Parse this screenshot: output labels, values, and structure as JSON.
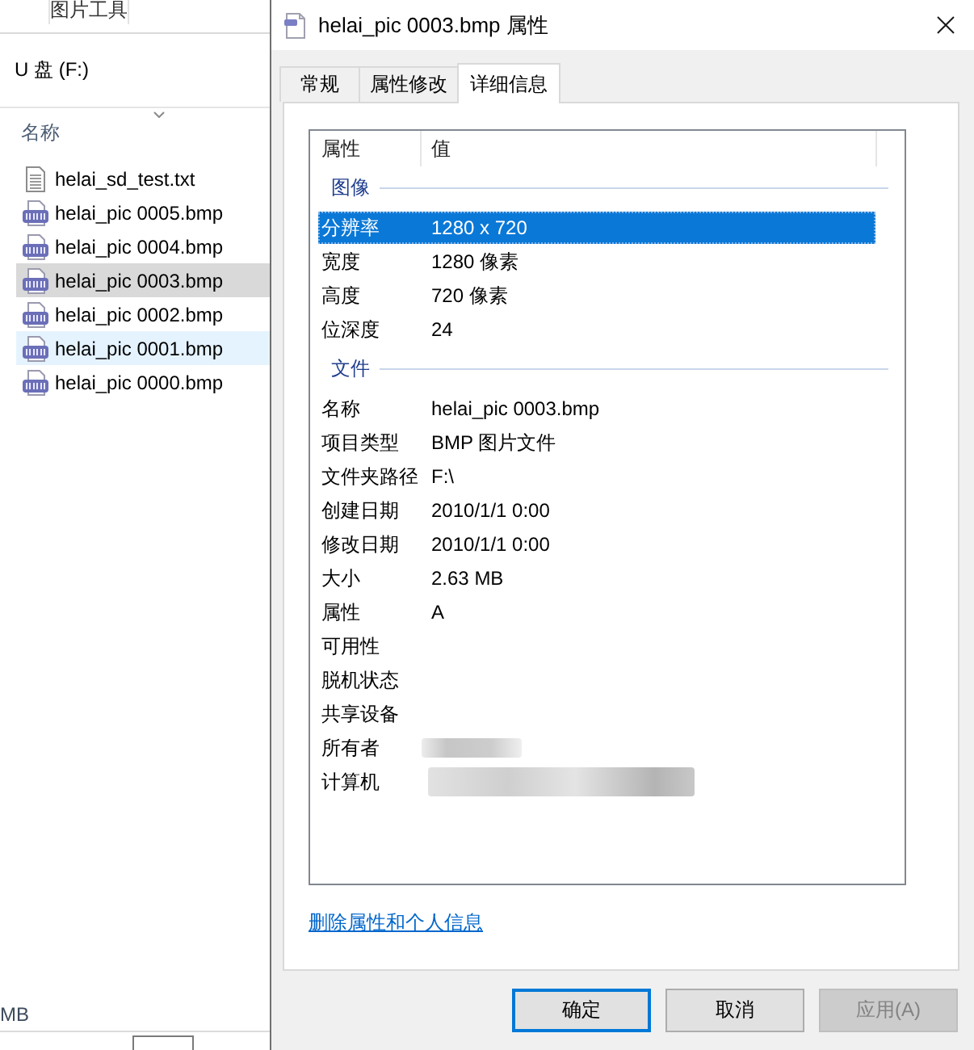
{
  "explorer": {
    "ribbon_tab": "图片工具",
    "location": "U 盘 (F:)",
    "column_header": "名称",
    "files": [
      {
        "name": "helai_sd_test.txt",
        "kind": "text",
        "selected": false,
        "hovered": false
      },
      {
        "name": "helai_pic 0005.bmp",
        "kind": "image",
        "selected": false,
        "hovered": false
      },
      {
        "name": "helai_pic 0004.bmp",
        "kind": "image",
        "selected": false,
        "hovered": false
      },
      {
        "name": "helai_pic 0003.bmp",
        "kind": "image",
        "selected": true,
        "hovered": false
      },
      {
        "name": "helai_pic 0002.bmp",
        "kind": "image",
        "selected": false,
        "hovered": false
      },
      {
        "name": "helai_pic 0001.bmp",
        "kind": "image",
        "selected": false,
        "hovered": true
      },
      {
        "name": "helai_pic 0000.bmp",
        "kind": "image",
        "selected": false,
        "hovered": false
      }
    ],
    "status_text": "MB"
  },
  "dialog": {
    "title": "helai_pic 0003.bmp 属性",
    "tabs": [
      {
        "label": "常规",
        "selected": false
      },
      {
        "label": "属性修改",
        "selected": false
      },
      {
        "label": "详细信息",
        "selected": true
      }
    ],
    "columns": [
      "属性",
      "值"
    ],
    "groups": [
      {
        "label": "图像",
        "rows": [
          {
            "property": "分辨率",
            "value": "1280 x 720",
            "selected": true,
            "redacted": false
          },
          {
            "property": "宽度",
            "value": "1280 像素",
            "selected": false,
            "redacted": false
          },
          {
            "property": "高度",
            "value": "720 像素",
            "selected": false,
            "redacted": false
          },
          {
            "property": "位深度",
            "value": "24",
            "selected": false,
            "redacted": false
          }
        ]
      },
      {
        "label": "文件",
        "rows": [
          {
            "property": "名称",
            "value": "helai_pic 0003.bmp",
            "selected": false,
            "redacted": false
          },
          {
            "property": "项目类型",
            "value": "BMP 图片文件",
            "selected": false,
            "redacted": false
          },
          {
            "property": "文件夹路径",
            "value": "F:\\",
            "selected": false,
            "redacted": false
          },
          {
            "property": "创建日期",
            "value": "2010/1/1 0:00",
            "selected": false,
            "redacted": false
          },
          {
            "property": "修改日期",
            "value": "2010/1/1 0:00",
            "selected": false,
            "redacted": false
          },
          {
            "property": "大小",
            "value": "2.63 MB",
            "selected": false,
            "redacted": false
          },
          {
            "property": "属性",
            "value": "A",
            "selected": false,
            "redacted": false
          },
          {
            "property": "可用性",
            "selected": false,
            "redacted": false
          },
          {
            "property": "脱机状态",
            "selected": false,
            "redacted": false
          },
          {
            "property": "共享设备",
            "selected": false,
            "redacted": false
          },
          {
            "property": "所有者",
            "selected": false,
            "redacted": true
          },
          {
            "property": "计算机",
            "selected": false,
            "redacted": true
          }
        ]
      }
    ],
    "link": "删除属性和个人信息",
    "buttons": [
      {
        "label": "确定",
        "kind": "default",
        "disabled": false
      },
      {
        "label": "取消",
        "kind": "normal",
        "disabled": false
      },
      {
        "label": "应用(A)",
        "kind": "normal",
        "disabled": true
      }
    ]
  }
}
